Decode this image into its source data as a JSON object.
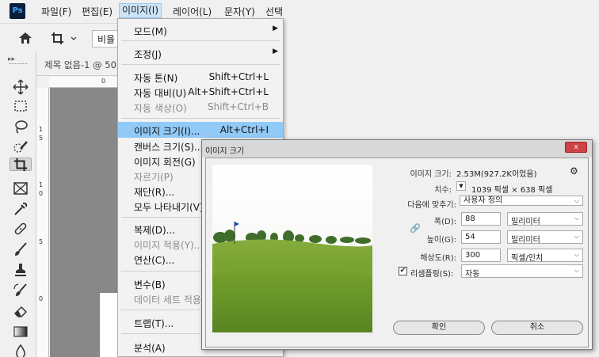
{
  "app": {
    "logo_text": "Ps"
  },
  "menubar": {
    "items": [
      "파일(F)",
      "편집(E)",
      "이미지(I)",
      "레이어(L)",
      "문자(Y)",
      "선택"
    ]
  },
  "options_bar": {
    "ratio_value": "비율"
  },
  "document": {
    "tab_title": "제목 없음-1 @ 50",
    "ruler_top": "0",
    "ruler_left": [
      "1",
      "5",
      "1",
      "0",
      "5",
      "0"
    ]
  },
  "image_menu": {
    "items": [
      {
        "label": "모드(M)",
        "shortcut": "",
        "submenu": true,
        "disabled": false
      },
      {
        "label": "조정(J)",
        "shortcut": "",
        "submenu": true,
        "disabled": false
      },
      {
        "label": "자동 톤(N)",
        "shortcut": "Shift+Ctrl+L",
        "disabled": false
      },
      {
        "label": "자동 대비(U)",
        "shortcut": "Alt+Shift+Ctrl+L",
        "disabled": false
      },
      {
        "label": "자동 색상(O)",
        "shortcut": "Shift+Ctrl+B",
        "disabled": true
      },
      {
        "label": "이미지 크기(I)...",
        "shortcut": "Alt+Ctrl+I",
        "disabled": false,
        "highlighted": true
      },
      {
        "label": "캔버스 크기(S)...",
        "shortcut": "",
        "disabled": false
      },
      {
        "label": "이미지 회전(G)",
        "shortcut": "",
        "disabled": false
      },
      {
        "label": "자르기(P)",
        "shortcut": "",
        "disabled": true
      },
      {
        "label": "재단(R)...",
        "shortcut": "",
        "disabled": false
      },
      {
        "label": "모두 나타내기(V)",
        "shortcut": "",
        "disabled": false
      },
      {
        "label": "복제(D)...",
        "shortcut": "",
        "disabled": false
      },
      {
        "label": "이미지 적용(Y)...",
        "shortcut": "",
        "disabled": true
      },
      {
        "label": "연산(C)...",
        "shortcut": "",
        "disabled": false
      },
      {
        "label": "변수(B)",
        "shortcut": "",
        "disabled": false
      },
      {
        "label": "데이터 세트 적용",
        "shortcut": "",
        "disabled": true
      },
      {
        "label": "트랩(T)...",
        "shortcut": "",
        "disabled": false
      },
      {
        "label": "분석(A)",
        "shortcut": "",
        "disabled": false
      }
    ]
  },
  "dialog": {
    "title": "이미지 크기",
    "close_label": "x",
    "image_size_label": "이미지 크기:",
    "image_size_value": "2.53M(927.2K이었음)",
    "dimensions_label": "치수:",
    "dimensions_value": "1039 픽셀 × 638 픽셀",
    "fit_to_label": "다음에 맞추기:",
    "fit_to_value": "사용자 정의",
    "width_label": "폭(D):",
    "width_value": "88",
    "width_unit": "밀리미터",
    "height_label": "높이(G):",
    "height_value": "54",
    "height_unit": "밀리미터",
    "resolution_label": "해상도(R):",
    "resolution_value": "300",
    "resolution_unit": "픽셀/인치",
    "resample_label": "리샘플링(S):",
    "resample_checked": true,
    "resample_value": "자동",
    "ok_label": "확인",
    "cancel_label": "취소"
  }
}
